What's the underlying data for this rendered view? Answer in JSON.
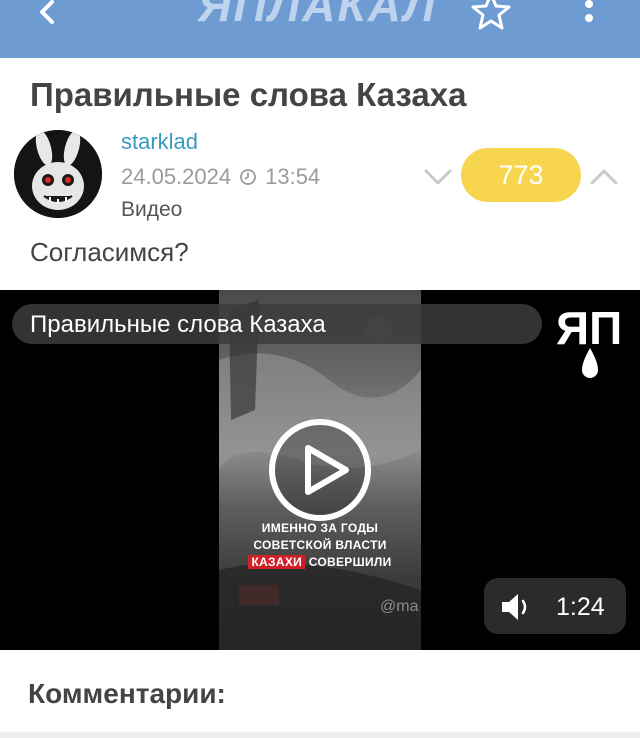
{
  "header": {
    "logo_text": "ЯПЛАКАЛ",
    "bar_color": "#6e9bd2",
    "icons": [
      "chevron-left-icon",
      "star-icon",
      "more-vertical-icon"
    ]
  },
  "post": {
    "title": "Правильные слова Казаха",
    "author": "starklad",
    "date": "24.05.2024",
    "time": "13:54",
    "category": "Видео",
    "rating": "773",
    "rating_color": "#f7d54e",
    "text": "Согласимся?"
  },
  "video": {
    "title": "Правильные слова Казаха",
    "overlay_lines": [
      "ИМЕННО ЗА ГОДЫ",
      "СОВЕТСКОЙ ВЛАСТИ"
    ],
    "overlay_red": "КАЗАХИ",
    "overlay_tail": "СОВЕРШИЛИ",
    "watermark": "@ma",
    "duration": "1:24"
  },
  "comments": {
    "title": "Комментарии:"
  }
}
